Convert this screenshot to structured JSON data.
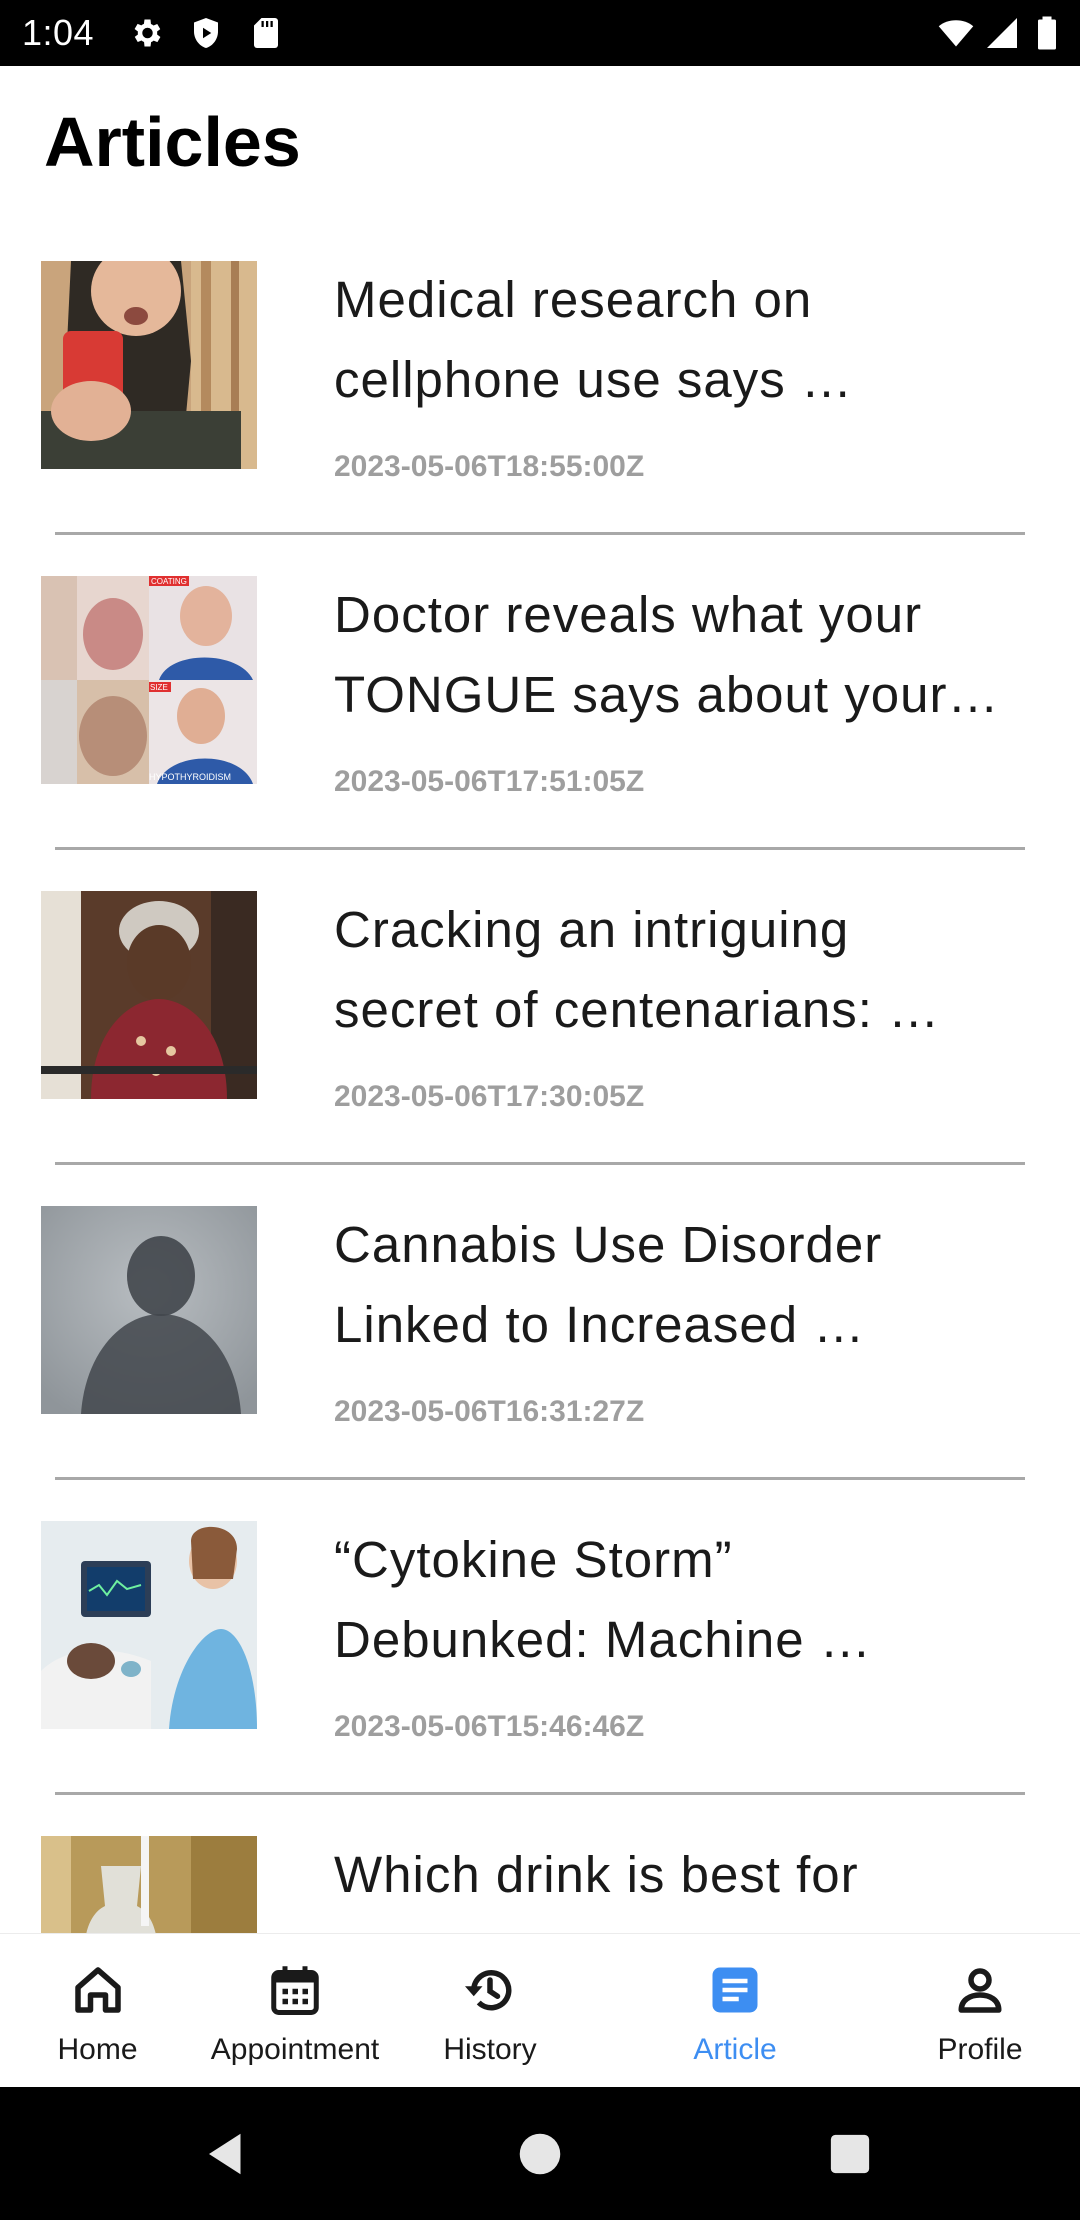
{
  "status_bar": {
    "time": "1:04",
    "left_icons": [
      "gear-icon",
      "shield-play-icon",
      "sd-card-icon"
    ],
    "right_icons": [
      "wifi-icon",
      "cellular-signal-icon",
      "battery-icon"
    ]
  },
  "header": {
    "title": "Articles"
  },
  "articles": [
    {
      "title_line1": "Medical research on",
      "title_line2": "cellphone use says …",
      "date": "2023-05-06T18:55:00Z",
      "thumbnail": "woman-with-phone-photo"
    },
    {
      "title_line1": "Doctor reveals what your",
      "title_line2": "TONGUE says about your…",
      "date": "2023-05-06T17:51:05Z",
      "thumbnail": "tongue-collage-photo",
      "thumb_labels": [
        "COATING",
        "SIZE",
        "HYPOTHYROIDISM"
      ]
    },
    {
      "title_line1": "Cracking an intriguing",
      "title_line2": "secret of centenarians: …",
      "date": "2023-05-06T17:30:05Z",
      "thumbnail": "elderly-woman-photo"
    },
    {
      "title_line1": "Cannabis Use Disorder",
      "title_line2": "Linked to Increased …",
      "date": "2023-05-06T16:31:27Z",
      "thumbnail": "blurred-silhouette-photo"
    },
    {
      "title_line1": "“Cytokine Storm”",
      "title_line2": "Debunked: Machine …",
      "date": "2023-05-06T15:46:46Z",
      "thumbnail": "hospital-patient-photo"
    },
    {
      "title_line1": "Which drink is best for",
      "title_line2": "",
      "date": "",
      "thumbnail": "drink-glass-photo"
    }
  ],
  "bottom_nav": {
    "items": [
      {
        "label": "Home",
        "icon": "home-icon",
        "active": false
      },
      {
        "label": "Appointment",
        "icon": "calendar-icon",
        "active": false
      },
      {
        "label": "History",
        "icon": "history-icon",
        "active": false
      },
      {
        "label": "Article",
        "icon": "article-icon",
        "active": true
      },
      {
        "label": "Profile",
        "icon": "profile-icon",
        "active": false
      }
    ],
    "active_color": "#3d8ef2",
    "inactive_color": "#1a1a1a"
  },
  "system_nav": {
    "buttons": [
      "back-icon",
      "home-circle-icon",
      "recents-icon"
    ]
  }
}
